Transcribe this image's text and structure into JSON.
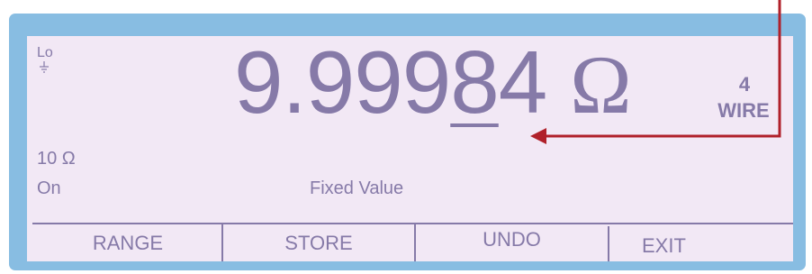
{
  "display": {
    "input_level": "Lo",
    "ground_icon": "ground-icon",
    "reading": {
      "integer_part": "9.999",
      "active_digit": "8",
      "trailing_digits": "4",
      "unit": "Ω",
      "value": 9.99984
    },
    "wire_count": "4",
    "wire_label": "WIRE",
    "range": "10 Ω",
    "state": "On",
    "mode": "Fixed Value"
  },
  "softkeys": [
    "RANGE",
    "STORE",
    "UNDO",
    "EXIT"
  ],
  "colors": {
    "bezel": "#88bde2",
    "screen": "#f2e8f5",
    "display_text": "#867aa8",
    "annotation_arrow": "#b0202a"
  }
}
